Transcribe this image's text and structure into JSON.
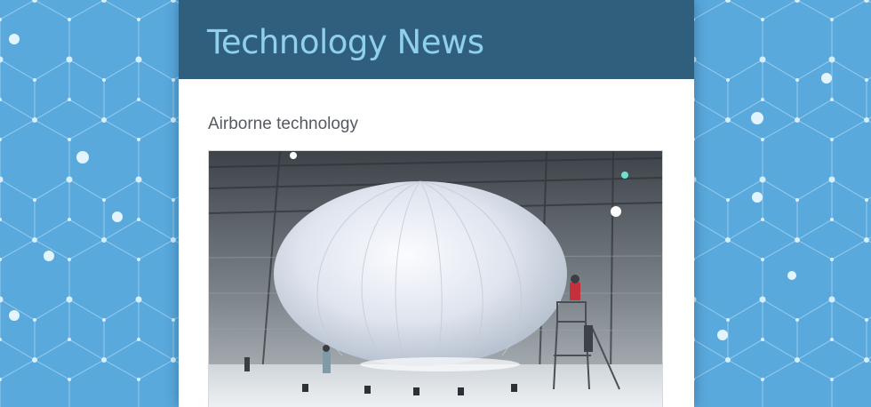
{
  "header": {
    "site_title": "Technology News"
  },
  "article": {
    "title": "Airborne technology",
    "image_icon": "balloon-in-hangar-photo"
  },
  "colors": {
    "background": "#5aa9dc",
    "header_bar": "#305f7e",
    "site_title": "#8fd0ec",
    "article_title": "#555a60",
    "page": "#ffffff"
  }
}
